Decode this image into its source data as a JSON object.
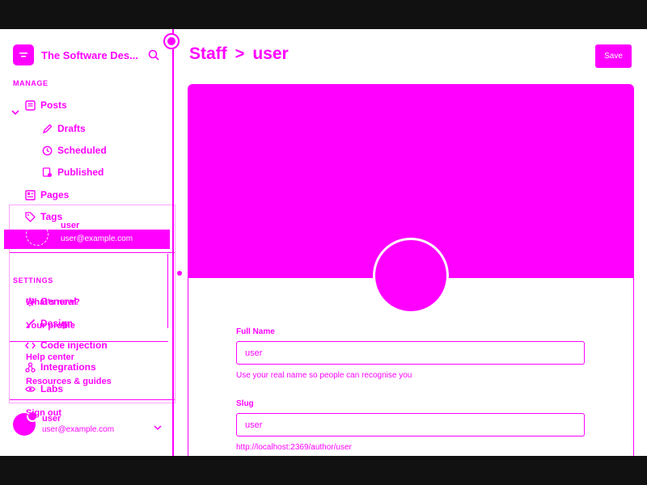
{
  "brand": {
    "title": "The Software Des..."
  },
  "sidebar": {
    "manage_label": "MANAGE",
    "settings_label": "SETTINGS",
    "posts": {
      "label": "Posts"
    },
    "posts_children": [
      {
        "label": "Drafts"
      },
      {
        "label": "Scheduled"
      },
      {
        "label": "Published"
      }
    ],
    "pages": {
      "label": "Pages"
    },
    "tags": {
      "label": "Tags"
    },
    "settings_items": [
      {
        "label": "General"
      },
      {
        "label": "Design"
      },
      {
        "label": "Code injection"
      },
      {
        "label": "Integrations"
      },
      {
        "label": "Labs"
      }
    ]
  },
  "footer_user": {
    "name": "user",
    "email": "user@example.com"
  },
  "popup": {
    "name": "user",
    "email": "user@example.com",
    "items": [
      {
        "label": "What's new?"
      },
      {
        "label": "Your profile"
      },
      {
        "label": "Help center"
      },
      {
        "label": "Resources & guides"
      },
      {
        "label": "Sign out"
      }
    ]
  },
  "main": {
    "breadcrumb_parent": "Staff",
    "breadcrumb_sep": ">",
    "breadcrumb_current": "user",
    "save_button": "Save"
  },
  "profile": {
    "full_name_label": "Full Name",
    "full_name_value": "user",
    "full_name_help": "Use your real name so people can recognise you",
    "slug_label": "Slug",
    "slug_value": "user",
    "slug_help": "http://localhost:2369/author/user"
  },
  "colors": {
    "accent": "#ff00ff",
    "frame": "#111111",
    "background": "#ffffff"
  }
}
